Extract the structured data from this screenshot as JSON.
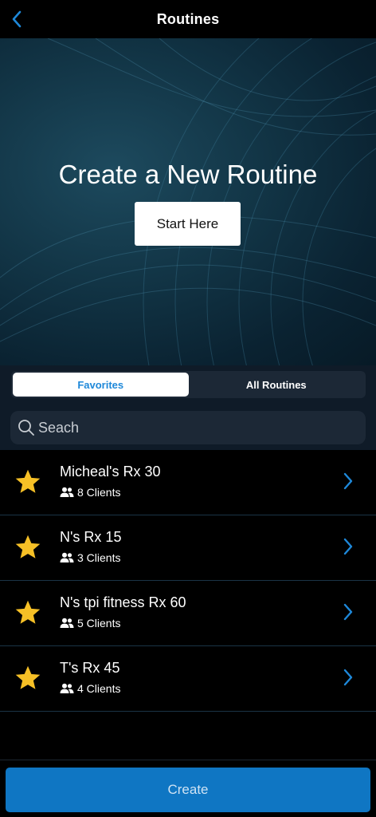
{
  "header": {
    "title": "Routines",
    "back_icon": "chevron-left-icon"
  },
  "hero": {
    "title": "Create a New Routine",
    "cta_label": "Start Here"
  },
  "tabs": [
    {
      "label": "Favorites",
      "active": true
    },
    {
      "label": "All Routines",
      "active": false
    }
  ],
  "search": {
    "placeholder": "Seach",
    "value": "",
    "icon": "search-icon"
  },
  "routines": [
    {
      "name": "Micheal's Rx 30",
      "clients": "8 Clients",
      "favorite": true
    },
    {
      "name": "N's Rx 15",
      "clients": "3 Clients",
      "favorite": true
    },
    {
      "name": "N's tpi fitness Rx 60",
      "clients": "5 Clients",
      "favorite": true
    },
    {
      "name": "T's Rx 45",
      "clients": "4 Clients",
      "favorite": true
    }
  ],
  "footer": {
    "create_label": "Create"
  },
  "colors": {
    "accent": "#1e88d9",
    "create_button": "#0f76c3",
    "star": "#f6c026",
    "panel": "#0f1b28"
  }
}
